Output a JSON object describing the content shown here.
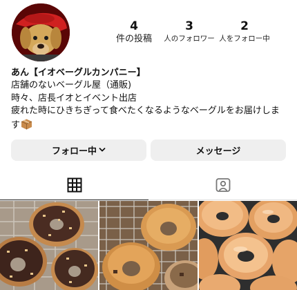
{
  "profile": {
    "stats": [
      {
        "count": "4",
        "label": "件の投稿"
      },
      {
        "count": "3",
        "label": "人のフォロワー"
      },
      {
        "count": "2",
        "label": "人をフォロー中"
      }
    ],
    "name": "あん【イオベーグルカンパニー】",
    "bio_lines": [
      "店舗のないベーグル屋（通販)",
      "時々、店長イオとイベント出店",
      "疲れた時にひきちぎって食べたくなるようなベーグルをお届けしま",
      "す"
    ],
    "bio_emoji": "package-icon"
  },
  "actions": {
    "follow_label": "フォロー中",
    "message_label": "メッセージ"
  },
  "tabs": {
    "grid_icon": "grid-icon",
    "tagged_icon": "tagged-person-icon"
  },
  "photos": [
    {
      "subject": "chocolate-glazed bagels with nuts"
    },
    {
      "subject": "plain bagels on cooling rack"
    },
    {
      "subject": "glossy bagels on tray"
    }
  ]
}
